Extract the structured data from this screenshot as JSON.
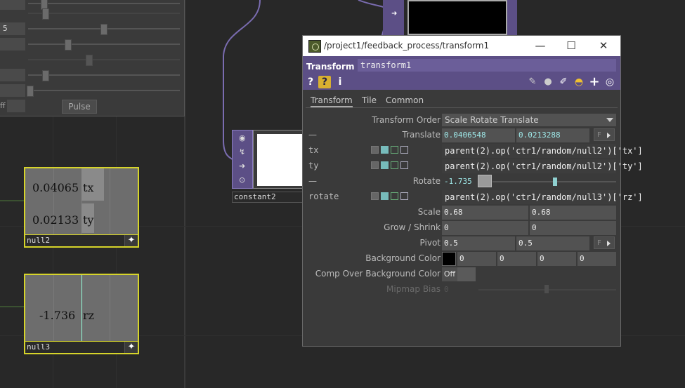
{
  "left_panel": {
    "field_value_1": "5",
    "toggle_label": "ff",
    "pulse_label": "Pulse"
  },
  "nodes": {
    "null2": {
      "name": "null2",
      "tx_value": "0.04065",
      "tx_label": "tx",
      "ty_value": "0.02133",
      "ty_label": "ty"
    },
    "null3": {
      "name": "null3",
      "rz_value": "-1.736",
      "rz_label": "rz"
    },
    "constant2": {
      "name": "constant2"
    }
  },
  "dialog": {
    "title": "/project1/feedback_process/transform1",
    "minimize": "—",
    "maximize": "☐",
    "close": "✕",
    "op_type": "Transform",
    "op_name": "transform1",
    "header_icons_left": [
      "help-icon",
      "python-help-icon",
      "info-icon"
    ],
    "header_icons_right": [
      "pencil-icon",
      "comment-icon",
      "clipboard-icon",
      "python-icon",
      "plus-icon",
      "target-icon"
    ],
    "help_glyph": "?",
    "info_glyph": "i",
    "tabs": [
      "Transform",
      "Tile",
      "Common"
    ],
    "params": {
      "transform_order": {
        "label": "Transform Order",
        "value": "Scale Rotate Translate"
      },
      "translate": {
        "label": "Translate",
        "x": "0.0406548",
        "y": "0.0213288",
        "mode": "F"
      },
      "tx": {
        "name": "tx",
        "expr": "parent(2).op('ctr1/random/null2')['tx']"
      },
      "ty": {
        "name": "ty",
        "expr": "parent(2).op('ctr1/random/null2')['ty']"
      },
      "rotate": {
        "label": "Rotate",
        "value": "-1.735",
        "slider_fraction": 0.5
      },
      "rotate_expr": {
        "name": "rotate",
        "expr": "parent(2).op('ctr1/random/null3')['rz']"
      },
      "scale": {
        "label": "Scale",
        "x": "0.68",
        "y": "0.68"
      },
      "grow_shrink": {
        "label": "Grow / Shrink",
        "x": "0",
        "y": "0"
      },
      "pivot": {
        "label": "Pivot",
        "x": "0.5",
        "y": "0.5",
        "mode": "F"
      },
      "bg_color": {
        "label": "Background Color",
        "swatch": "#000000",
        "r": "0",
        "g": "0",
        "b": "0",
        "a": "0"
      },
      "comp_over": {
        "label": "Comp Over Background Color",
        "value": "Off"
      },
      "mipmap": {
        "label": "Mipmap Bias",
        "value": "0"
      }
    },
    "dash": "—"
  },
  "colors": {
    "accent_purple": "#5c4f86",
    "selected_yellow": "#d6d42a",
    "wire_purple": "#7a6cb0",
    "expr_cyan": "#9ee8e8"
  }
}
